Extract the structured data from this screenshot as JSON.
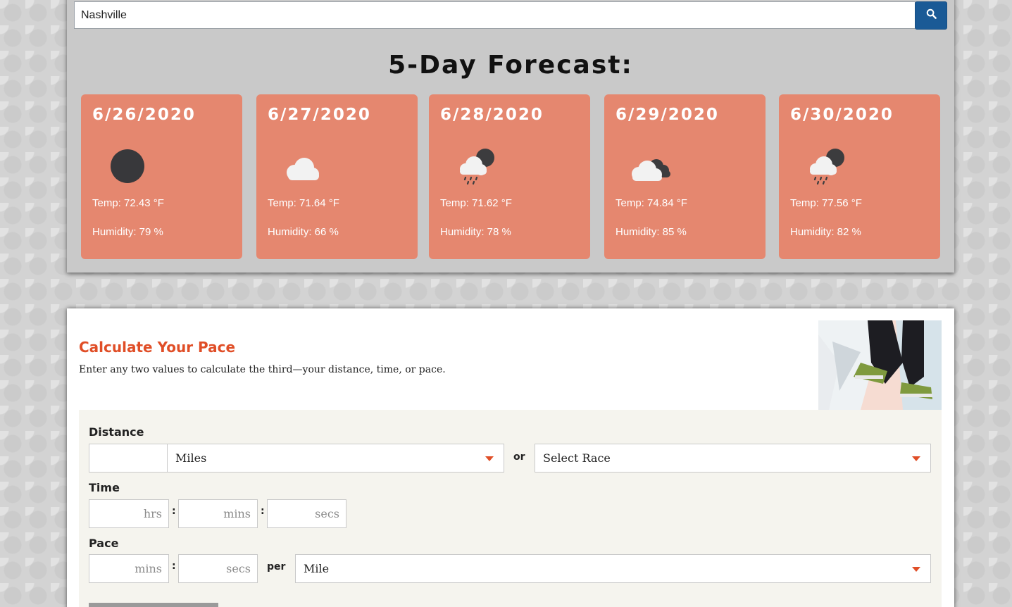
{
  "search": {
    "value": "Nashville",
    "button_icon": "search-icon",
    "button_color": "#1a5a96"
  },
  "forecast": {
    "title": "5-Day Forecast:",
    "card_color": "#e5876f",
    "days": [
      {
        "date": "6/26/2020",
        "icon": "clear-night-moon-icon",
        "temp": "Temp: 72.43 °F",
        "humidity": "Humidity: 79 %"
      },
      {
        "date": "6/27/2020",
        "icon": "cloud-icon",
        "temp": "Temp: 71.64 °F",
        "humidity": "Humidity: 66 %"
      },
      {
        "date": "6/28/2020",
        "icon": "rain-cloud-icon",
        "temp": "Temp: 71.62 °F",
        "humidity": "Humidity: 78 %"
      },
      {
        "date": "6/29/2020",
        "icon": "broken-clouds-icon",
        "temp": "Temp: 74.84 °F",
        "humidity": "Humidity: 85 %"
      },
      {
        "date": "6/30/2020",
        "icon": "rain-cloud-icon",
        "temp": "Temp: 77.56 °F",
        "humidity": "Humidity: 82 %"
      }
    ]
  },
  "pace": {
    "title": "Calculate Your Pace",
    "description": "Enter any two values to calculate the third—your distance, time, or pace.",
    "accent_color": "#e04e27",
    "distance": {
      "label": "Distance",
      "value": "",
      "unit_selected": "Miles",
      "or_label": "or",
      "race_selected": "Select Race"
    },
    "time": {
      "label": "Time",
      "hrs_placeholder": "hrs",
      "mins_placeholder": "mins",
      "secs_placeholder": "secs",
      "separator": ":"
    },
    "pace_row": {
      "label": "Pace",
      "mins_placeholder": "mins",
      "secs_placeholder": "secs",
      "separator": ":",
      "per_label": "per",
      "per_selected": "Mile"
    }
  }
}
